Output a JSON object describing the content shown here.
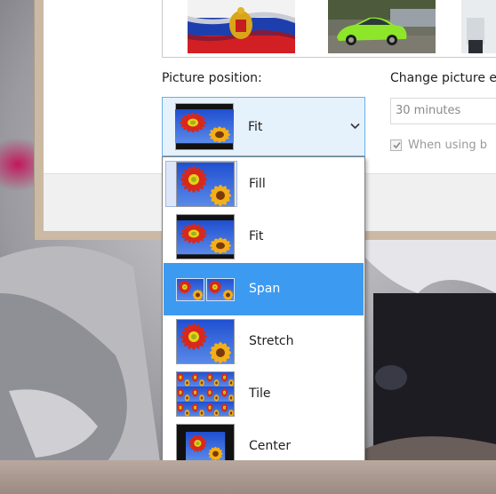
{
  "window": {
    "picture_position_label": "Picture position:",
    "change_every_label": "Change picture e",
    "interval_value": "30 minutes",
    "shuffle_label": "When using b",
    "shuffle_checked": true
  },
  "position_combo": {
    "selected_value": "Fit"
  },
  "position_options": [
    {
      "label": "Fill",
      "icon": "fill-preview-icon"
    },
    {
      "label": "Fit",
      "icon": "fit-preview-icon"
    },
    {
      "label": "Span",
      "icon": "span-preview-icon"
    },
    {
      "label": "Stretch",
      "icon": "stretch-preview-icon"
    },
    {
      "label": "Tile",
      "icon": "tile-preview-icon"
    },
    {
      "label": "Center",
      "icon": "center-preview-icon"
    }
  ],
  "colors": {
    "selection": "#3d9af1",
    "combo_hover": "#e5f1fb",
    "combo_border": "#6ab0e3"
  }
}
